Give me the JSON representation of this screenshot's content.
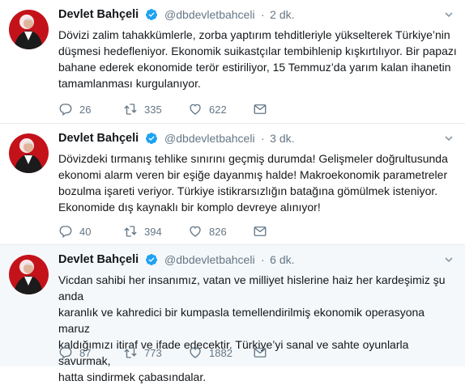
{
  "colors": {
    "accent": "#1da1f2",
    "muted": "#657786",
    "text": "#14171a",
    "avatar_red": "#c4121a"
  },
  "tweets": [
    {
      "name": "Devlet Bahçeli",
      "handle": "@dbdevletbahceli",
      "separator": "·",
      "time": "2 dk.",
      "text": "Dövizi zalim tahakkümlerle, zorba yaptırım tehditleriyle yükselterek Türkiye’nin\ndüşmesi hedefleniyor. Ekonomik suikastçılar tembihlenip kışkırtılıyor. Bir papazı\nbahane ederek ekonomide terör estiriliyor, 15 Temmuz’da yarım kalan ihanetin\ntamamlanması kurgulanıyor.",
      "replies": "26",
      "retweets": "335",
      "likes": "622"
    },
    {
      "name": "Devlet Bahçeli",
      "handle": "@dbdevletbahceli",
      "separator": "·",
      "time": "3 dk.",
      "text": "Dövizdeki tırmanış tehlike sınırını geçmiş durumda! Gelişmeler doğrultusunda\nekonomi alarm veren bir eşiğe dayanmış halde! Makroekonomik parametreler\nbozulma işareti veriyor. Türkiye istikrarsızlığın batağına gömülmek isteniyor.\nEkonomide dış kaynaklı bir komplo devreye alınıyor!",
      "replies": "40",
      "retweets": "394",
      "likes": "826"
    },
    {
      "name": "Devlet Bahçeli",
      "handle": "@dbdevletbahceli",
      "separator": "·",
      "time": "6 dk.",
      "text": "Vicdan sahibi her insanımız, vatan ve milliyet hislerine haiz her kardeşimiz şu anda\nkaranlık ve kahredici bir kumpasla temellendirilmiş ekonomik operasyona maruz\nkaldığımızı itiraf ve ifade edecektir. Türkiye’yi sanal ve sahte oyunlarla savurmak,\nhatta sindirmek çabasındalar.",
      "replies": "87",
      "retweets": "773",
      "likes": "1882"
    }
  ]
}
